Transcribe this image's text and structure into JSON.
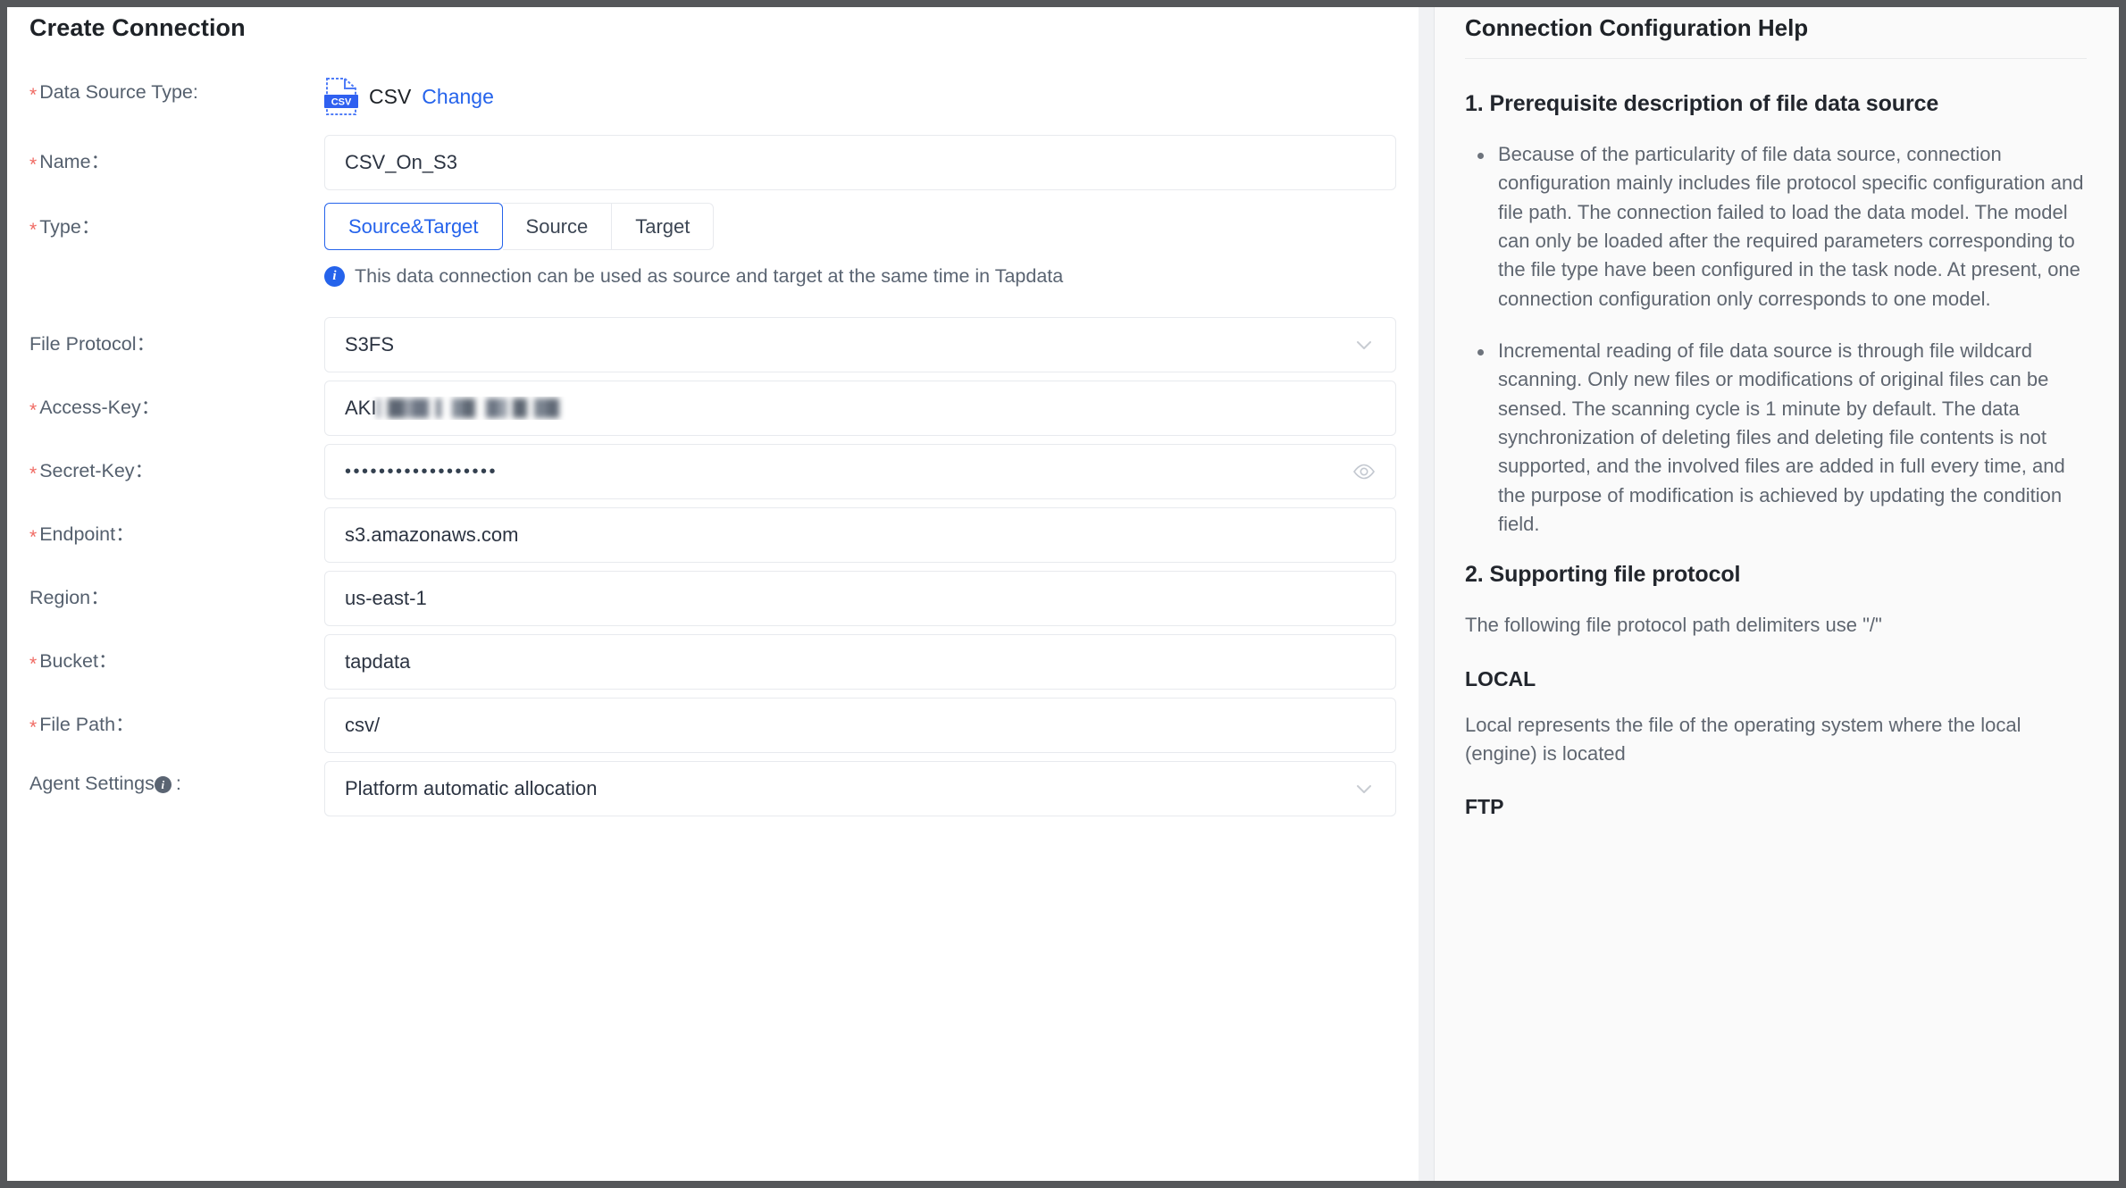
{
  "form": {
    "title": "Create Connection",
    "rows": [
      {
        "label": "Data Source Type",
        "required": true,
        "kind": "datasource",
        "icon": "csv-file-icon",
        "value": "CSV",
        "action_label": "Change"
      },
      {
        "label": "Name",
        "required": true,
        "kind": "input",
        "value": "CSV_On_S3",
        "placeholder": ""
      },
      {
        "label": "Type",
        "required": true,
        "kind": "segmented",
        "options": [
          "Source&Target",
          "Source",
          "Target"
        ],
        "selected": "Source&Target",
        "hint": "This data connection can be used as source and target at the same time in Tapdata",
        "hint_icon": "info-icon"
      },
      {
        "label": "File Protocol",
        "required": false,
        "kind": "select",
        "value": "S3FS",
        "icon": "chevron-down-icon"
      },
      {
        "label": "Access-Key",
        "required": true,
        "kind": "input-redacted",
        "value": "AKI",
        "redacted": true
      },
      {
        "label": "Secret-Key",
        "required": true,
        "kind": "password",
        "value": "••••••••••••••••••",
        "icon": "eye-icon"
      },
      {
        "label": "Endpoint",
        "required": true,
        "kind": "input",
        "value": "s3.amazonaws.com"
      },
      {
        "label": "Region",
        "required": false,
        "kind": "input",
        "value": "us-east-1"
      },
      {
        "label": "Bucket",
        "required": true,
        "kind": "input",
        "value": "tapdata"
      },
      {
        "label": "File Path",
        "required": true,
        "kind": "input",
        "value": "csv/"
      },
      {
        "label": "Agent Settings",
        "required": false,
        "kind": "select",
        "has_info": true,
        "info_icon": "info-icon",
        "value": "Platform automatic allocation",
        "icon": "chevron-down-icon"
      }
    ]
  },
  "help": {
    "title": "Connection Configuration Help",
    "section1_heading": "1. Prerequisite description of file data source",
    "bullets": [
      "Because of the particularity of file data source, connection configuration mainly includes file protocol specific configuration and file path. The connection failed to load the data model. The model can only be loaded after the required parameters corresponding to the file type have been configured in the task node. At present, one connection configuration only corresponds to one model.",
      "Incremental reading of file data source is through file wildcard scanning. Only new files or modifications of original files can be sensed. The scanning cycle is 1 minute by default. The data synchronization of deleting files and deleting file contents is not supported, and the involved files are added in full every time, and the purpose of modification is achieved by updating the condition field."
    ],
    "section2_heading": "2. Supporting file protocol",
    "section2_intro": "The following file protocol path delimiters use \"/\"",
    "local_heading": "LOCAL",
    "local_text": "Local represents the file of the operating system where the local (engine) is located",
    "ftp_heading": "FTP"
  },
  "colors": {
    "accent": "#2563eb",
    "required": "#f06a63",
    "label": "#55606e",
    "help_text": "#5f6670"
  }
}
